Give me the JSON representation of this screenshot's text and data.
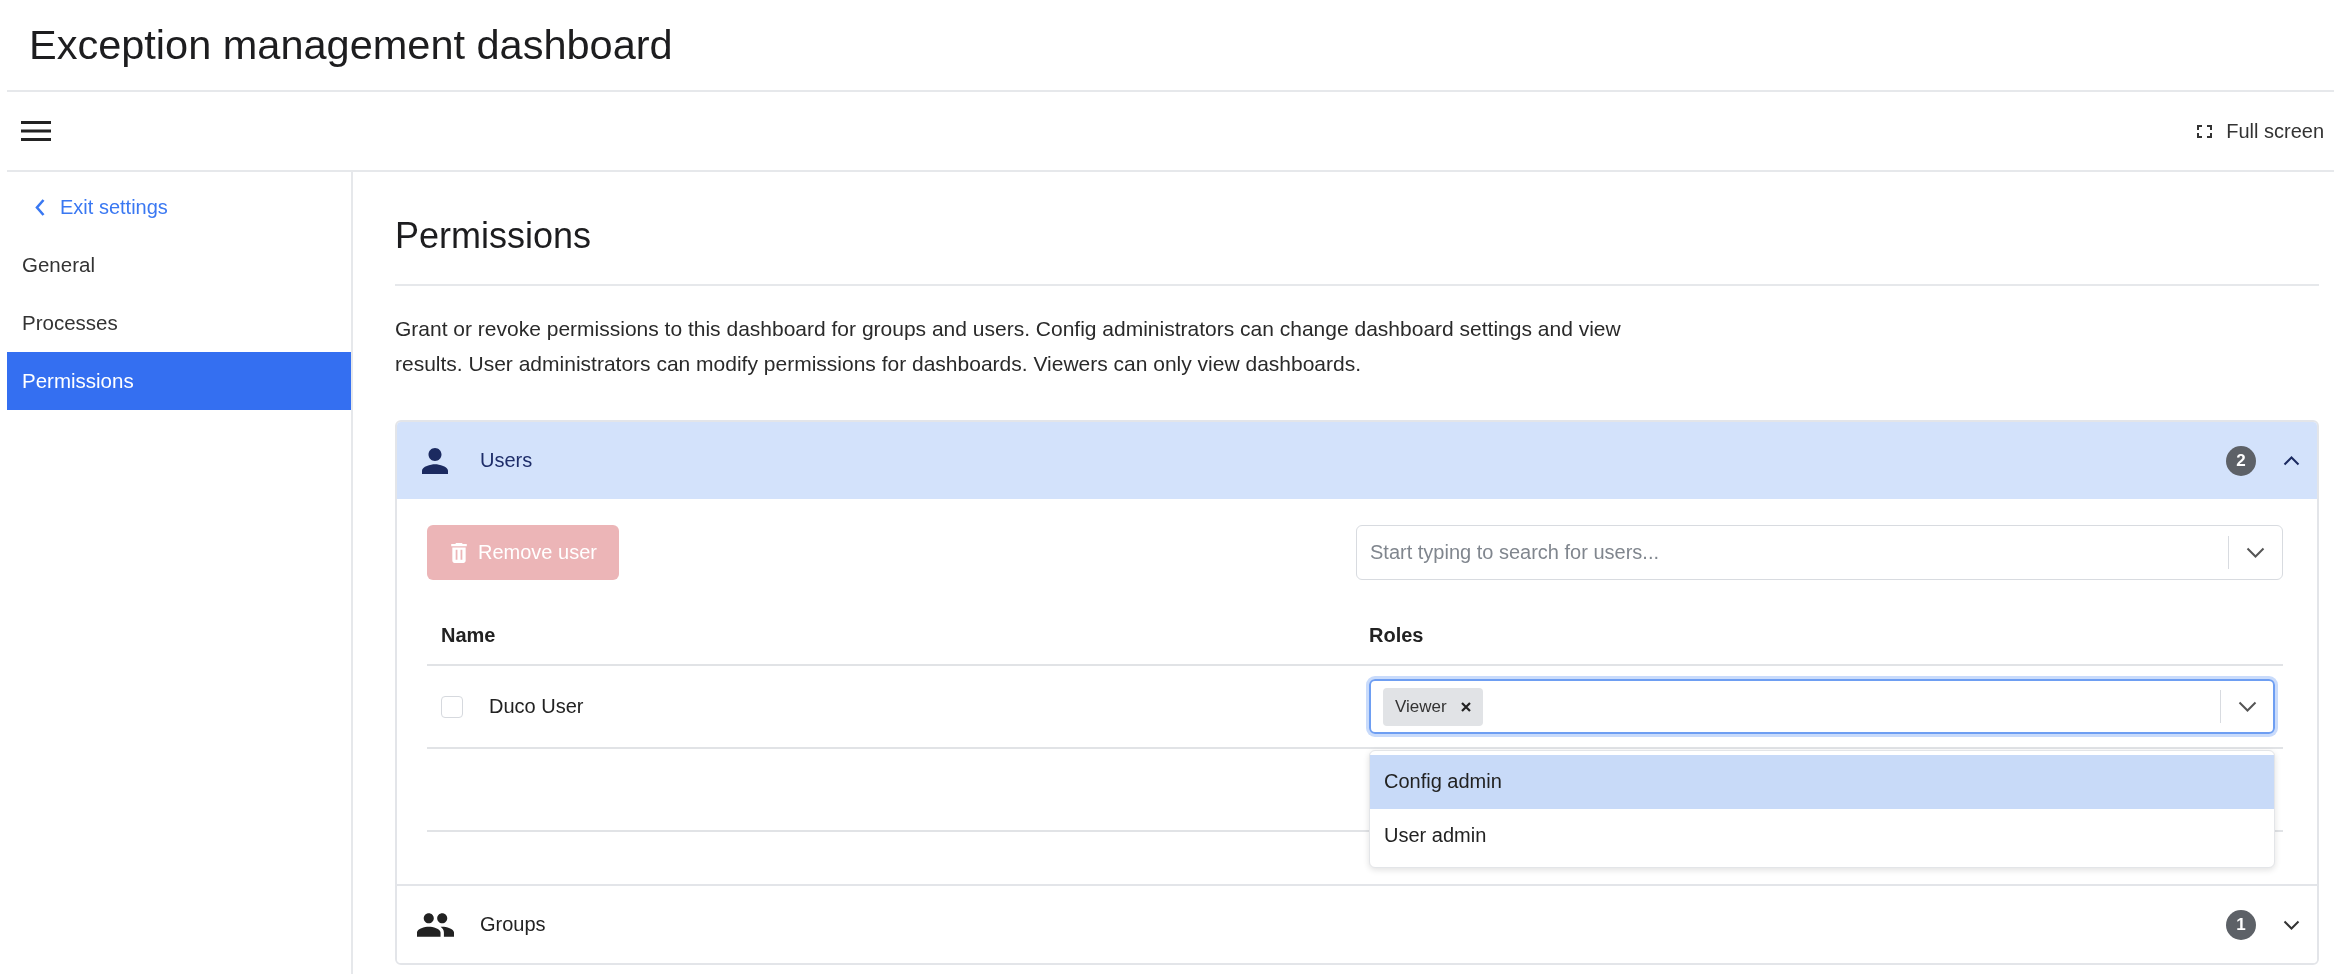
{
  "window": {
    "title": "Exception management dashboard"
  },
  "toolbar": {
    "full_screen_label": "Full screen"
  },
  "sidebar": {
    "back_link": "Exit settings",
    "items": [
      {
        "label": "General",
        "selected": false
      },
      {
        "label": "Processes",
        "selected": false
      },
      {
        "label": "Permissions",
        "selected": true
      }
    ]
  },
  "page": {
    "heading": "Permissions",
    "description": "Grant or revoke permissions to this dashboard for groups and users. Config administrators can change dashboard settings and view results. User administrators can modify permissions for dashboards. Viewers can only view dashboards."
  },
  "sections": [
    {
      "kind": "users",
      "title": "Users",
      "count": "2",
      "expanded": true,
      "remove_button": {
        "label": "Remove user",
        "disabled": true
      },
      "search": {
        "placeholder": "Start typing to search for users..."
      },
      "table": {
        "columns": [
          "Name",
          "Roles"
        ],
        "rows": [
          {
            "name": "Duco User",
            "checked": false,
            "roles": [
              "Viewer"
            ],
            "menu_open": true,
            "options": [
              {
                "label": "Config admin",
                "selected": true
              },
              {
                "label": "User admin",
                "selected": false
              }
            ]
          }
        ]
      }
    },
    {
      "kind": "groups",
      "title": "Groups",
      "count": "1",
      "expanded": false
    }
  ]
}
